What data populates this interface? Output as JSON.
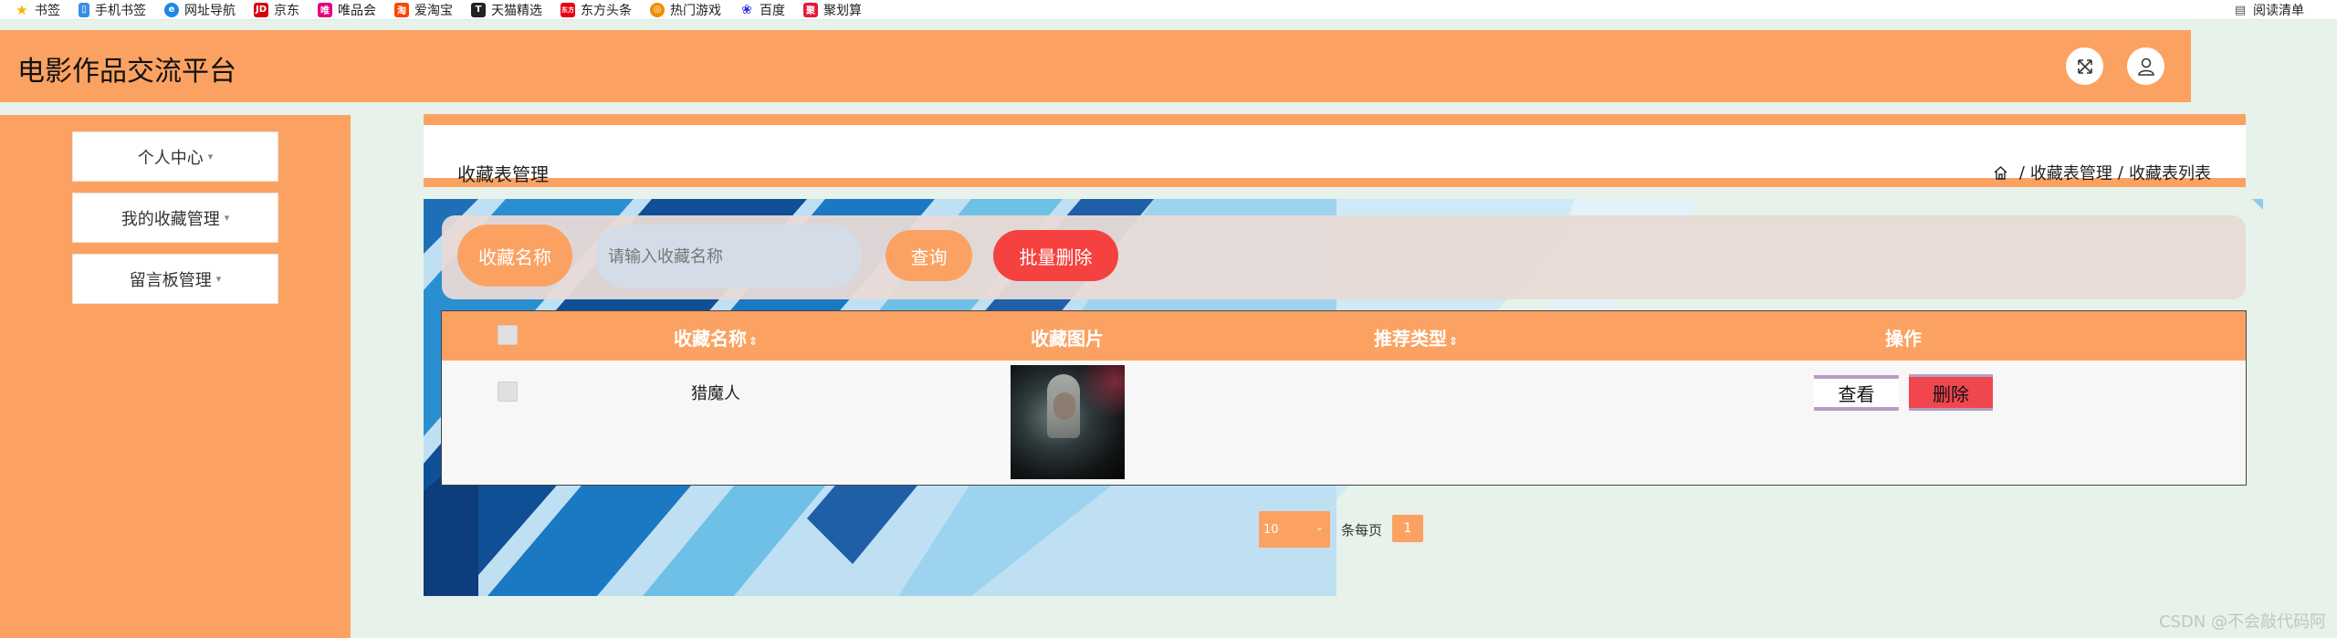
{
  "bookmarks": {
    "items": [
      {
        "label": "书签",
        "icon": "star-icon",
        "color": "#f5b400"
      },
      {
        "label": "手机书签",
        "icon": "phone-icon",
        "color": "#3a8ee6"
      },
      {
        "label": "网址导航",
        "icon": "compass-icon",
        "color": "#1e88e5"
      },
      {
        "label": "京东",
        "icon": "jd-icon",
        "color": "#d7000f"
      },
      {
        "label": "唯品会",
        "icon": "vip-icon",
        "color": "#e4007f"
      },
      {
        "label": "爱淘宝",
        "icon": "taobao-icon",
        "color": "#ff4400"
      },
      {
        "label": "天猫精选",
        "icon": "tmall-icon",
        "color": "#222222"
      },
      {
        "label": "东方头条",
        "icon": "news-icon",
        "color": "#e60012"
      },
      {
        "label": "热门游戏",
        "icon": "game-icon",
        "color": "#f08c00"
      },
      {
        "label": "百度",
        "icon": "baidu-icon",
        "color": "#2932e1"
      },
      {
        "label": "聚划算",
        "icon": "juhuasuan-icon",
        "color": "#e4193b"
      }
    ],
    "reading_list": "阅读清单"
  },
  "header": {
    "title": "电影作品交流平台",
    "fullscreen_icon": "fullscreen-icon",
    "user_icon": "user-icon"
  },
  "sidebar": {
    "items": [
      {
        "label": "个人中心"
      },
      {
        "label": "我的收藏管理"
      },
      {
        "label": "留言板管理"
      }
    ]
  },
  "breadcrumb": {
    "title": "收藏表管理",
    "home_icon": "home-icon",
    "path": [
      "收藏表管理",
      "收藏表列表"
    ],
    "separator": "/"
  },
  "search": {
    "field_label": "收藏名称",
    "placeholder": "请输入收藏名称",
    "query_button": "查询",
    "batch_delete_button": "批量删除"
  },
  "table": {
    "columns": [
      "收藏名称",
      "收藏图片",
      "推荐类型",
      "操作"
    ],
    "sortable": [
      true,
      false,
      true,
      false
    ],
    "rows": [
      {
        "name": "猎魔人",
        "image": "poster-thumbnail",
        "type": "",
        "actions": {
          "view": "查看",
          "delete": "删除"
        }
      }
    ]
  },
  "pagination": {
    "page_size": "10",
    "per_page_label": "条每页",
    "current_page": "1"
  },
  "watermark": "CSDN @不会敲代码阿",
  "colors": {
    "accent": "#fba262",
    "background": "#e6f2ea",
    "danger": "#f0474f",
    "batch_delete": "#f5413f",
    "border_purple": "#b69dc4"
  }
}
